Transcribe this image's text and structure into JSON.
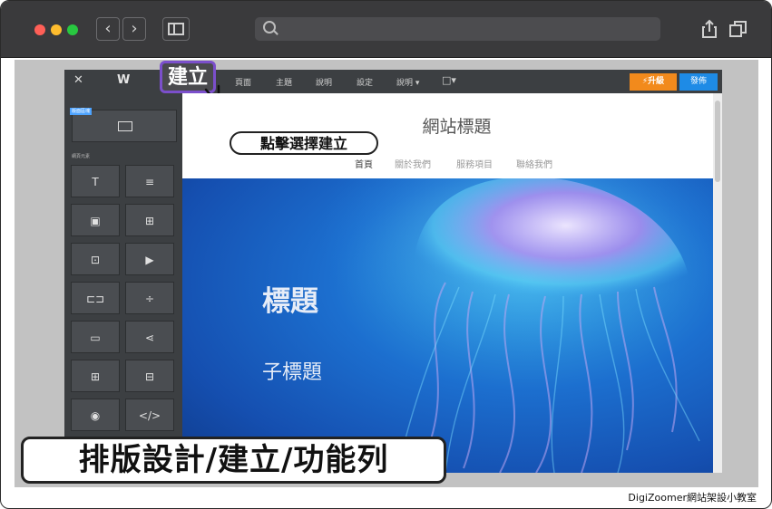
{
  "browser": {
    "nav_back": "‹",
    "nav_forward": "›"
  },
  "editor_bar": {
    "close": "✕",
    "logo": "W",
    "create_label": "建立",
    "menu": [
      "頁面",
      "主題",
      "說明",
      "設定",
      "說明 ▾",
      "□▾"
    ],
    "upgrade_label": "⚡升級",
    "publish_label": "發佈"
  },
  "panel": {
    "top_tag": "版面區塊",
    "section_label": "網頁元素",
    "tiles": [
      "T",
      "≡",
      "▣",
      "⊞",
      "⊡",
      "▶",
      "⊏⊐",
      "÷",
      "▭",
      "⋖",
      "⊞",
      "⊟",
      "◉",
      "</>"
    ]
  },
  "site": {
    "title": "網站標題",
    "nav": [
      "首頁",
      "關於我們",
      "服務項目",
      "聯絡我們"
    ],
    "hero_title": "標題",
    "hero_subtitle": "子標題"
  },
  "annotations": {
    "callout": "點擊選擇建立",
    "section_label": "排版設計/建立/功能列",
    "credit": "DigiZoomer網站架設小教室"
  },
  "colors": {
    "editor_dark": "#3c3f42",
    "upgrade": "#f28a1c",
    "publish": "#1e8be6",
    "highlight": "#7b4fcb"
  }
}
